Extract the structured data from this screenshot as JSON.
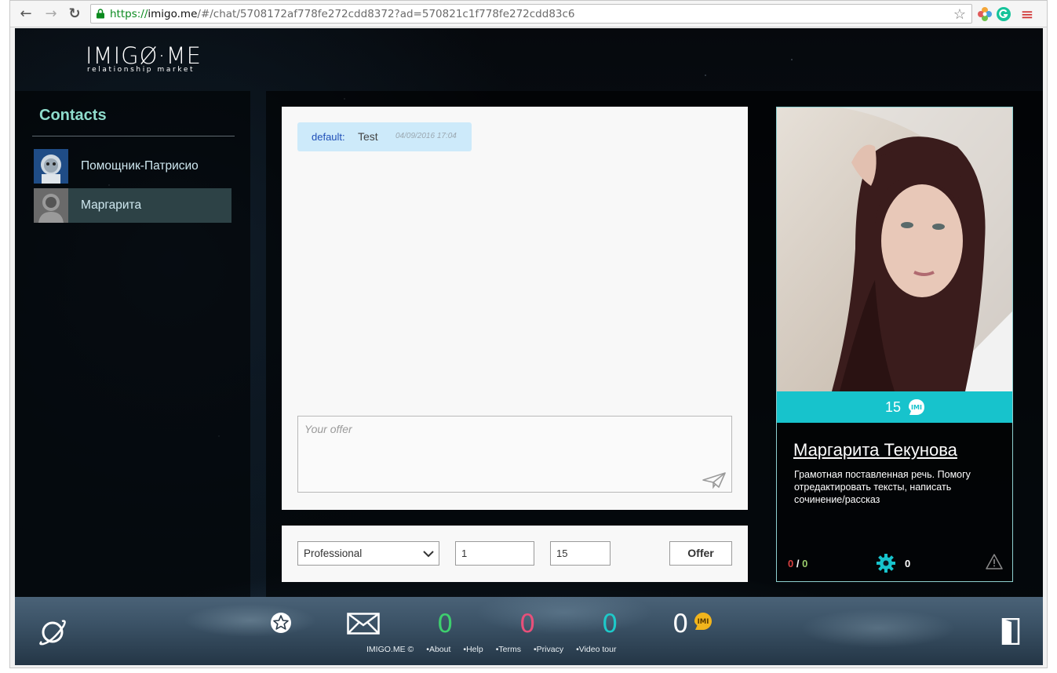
{
  "browser": {
    "url_scheme": "https://",
    "url_host": "imigo.me",
    "url_rest": "/#/chat/5708172af778fe272cdd8372?ad=570821c1f778fe272cdd83c6",
    "back_glyph": "←",
    "forward_glyph": "→",
    "reload_glyph": "↻",
    "star_glyph": "☆",
    "menu_glyph": "≡"
  },
  "logo": {
    "main": "IMIGØ·ME",
    "sub": "relationship market"
  },
  "sidebar": {
    "title": "Contacts",
    "contacts": [
      {
        "name": "Помощник-Патрисио",
        "active": false
      },
      {
        "name": "Маргарита",
        "active": true
      }
    ]
  },
  "chat": {
    "messages": [
      {
        "sender": "default:",
        "text": "Test",
        "time": "04/09/2016 17:04"
      }
    ],
    "offer_placeholder": "Your offer"
  },
  "offer_bar": {
    "category": "Professional",
    "field1": "1",
    "field2": "15",
    "button": "Offer"
  },
  "profile": {
    "price": "15",
    "name": "Маргарита Текунова",
    "description": "Грамотная поставленная речь. Помогу отредактировать тексты, написать сочинение/рассказ",
    "stat_a": "0",
    "stat_sep": " / ",
    "stat_b": "0",
    "gear_count": "0"
  },
  "footer": {
    "counters": [
      {
        "value": "0",
        "color": "#3ecf6e"
      },
      {
        "value": "0",
        "color": "#e8507a"
      },
      {
        "value": "0",
        "color": "#1ec9c9"
      },
      {
        "value": "0",
        "color": "#ffffff"
      }
    ],
    "links": [
      "IMIGO.ME ©",
      "About",
      "Help",
      "Terms",
      "Privacy",
      "Video tour"
    ]
  },
  "colors": {
    "accent": "#17c3cc",
    "contacts_title": "#8fdccc",
    "message_bubble": "#cdeafa"
  }
}
